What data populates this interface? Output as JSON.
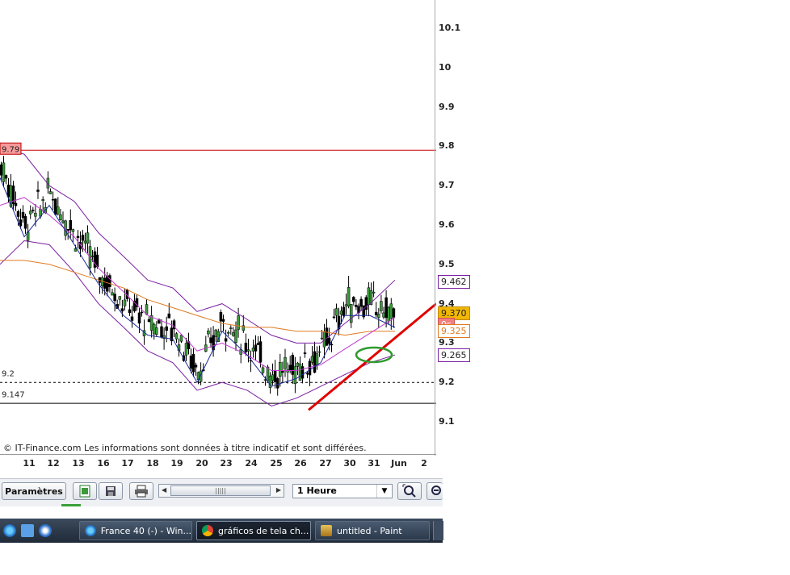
{
  "chart": {
    "copyright": "© IT-Finance.com Les informations sont données à titre indicatif et sont différées.",
    "price_ticks": [
      "10.1",
      "10",
      "9.9",
      "9.8",
      "9.7",
      "9.6",
      "9.5",
      "9.4",
      "9.3",
      "9.2",
      "9.1"
    ],
    "date_ticks": [
      "11",
      "12",
      "13",
      "16",
      "17",
      "18",
      "19",
      "20",
      "23",
      "24",
      "25",
      "26",
      "27",
      "30",
      "31",
      "Jun",
      "2"
    ],
    "level_labels": {
      "resistance": "9.79",
      "support_dashed": "9.2",
      "support_solid": "9.147"
    },
    "right_tags": {
      "upper_band": "9.462",
      "last_price": "9.370",
      "countdown": "0s",
      "ma": "9.325",
      "lower_band": "9.265"
    },
    "colors": {
      "resistance": "#cc0000",
      "upper_band": "#7a1fa2",
      "last_price": "#f2b705",
      "countdown": "#f08080",
      "ma": "#e07a20",
      "lower_band": "#7a1fa2",
      "trendline": "#e00000",
      "ellipse": "#2e9a2e"
    }
  },
  "chart_data": {
    "type": "line",
    "title": "",
    "xlabel": "",
    "ylabel": "",
    "ylim": [
      9.06,
      10.13
    ],
    "x": [
      "11",
      "12",
      "13",
      "16",
      "17",
      "18",
      "19",
      "20",
      "23",
      "24",
      "25",
      "26",
      "27",
      "30",
      "31",
      "Jun",
      "2"
    ],
    "series": [
      {
        "values": [
          9.75,
          9.6,
          9.68,
          9.58,
          9.48,
          9.4,
          9.35,
          9.34,
          9.23,
          9.36,
          9.3,
          9.22,
          9.24,
          9.28,
          9.4,
          9.4,
          9.37
        ]
      },
      {
        "values": [
          9.8,
          9.78,
          9.7,
          9.66,
          9.58,
          9.52,
          9.46,
          9.44,
          9.38,
          9.4,
          9.36,
          9.32,
          9.3,
          9.3,
          9.35,
          9.4,
          9.46
        ]
      },
      {
        "values": [
          9.5,
          9.56,
          9.55,
          9.48,
          9.4,
          9.34,
          9.28,
          9.25,
          9.18,
          9.2,
          9.18,
          9.14,
          9.16,
          9.19,
          9.22,
          9.25,
          9.27
        ]
      },
      {
        "values": [
          9.51,
          9.51,
          9.5,
          9.48,
          9.46,
          9.44,
          9.41,
          9.39,
          9.37,
          9.35,
          9.34,
          9.34,
          9.33,
          9.33,
          9.32,
          9.33,
          9.33
        ]
      }
    ],
    "horizontal_lines": [
      9.79,
      9.2,
      9.147
    ],
    "grid": false
  },
  "toolbar": {
    "params_label": "Paramètres",
    "timeframe": "1 Heure"
  },
  "taskbar": {
    "items": [
      "France 40 (-) - Win...",
      "gráficos de tela ch...",
      "untitled - Paint"
    ]
  }
}
